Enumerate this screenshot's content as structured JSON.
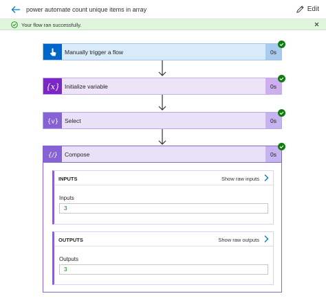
{
  "header": {
    "title": "power automate count unique items in array",
    "edit_label": "Edit"
  },
  "banner": {
    "message": "Your flow ran successfully."
  },
  "steps": [
    {
      "label": "Manually trigger a flow",
      "duration": "0s",
      "icon": "hand-touch-icon"
    },
    {
      "label": "Initialize variable",
      "duration": "0s",
      "icon": "variable-icon"
    },
    {
      "label": "Select",
      "duration": "0s",
      "icon": "data-operation-icon"
    },
    {
      "label": "Compose",
      "duration": "0s",
      "icon": "data-operation-icon"
    }
  ],
  "compose": {
    "inputs": {
      "heading": "INPUTS",
      "raw_label": "Show raw inputs",
      "field_label": "Inputs",
      "value": "3"
    },
    "outputs": {
      "heading": "OUTPUTS",
      "raw_label": "Show raw outputs",
      "field_label": "Outputs",
      "value": "3"
    }
  },
  "colors": {
    "accent": "#0078d4",
    "success": "#107c10",
    "trigger": "#0066cc",
    "variable": "#7b27c5",
    "data_operation": "#8662d4"
  }
}
